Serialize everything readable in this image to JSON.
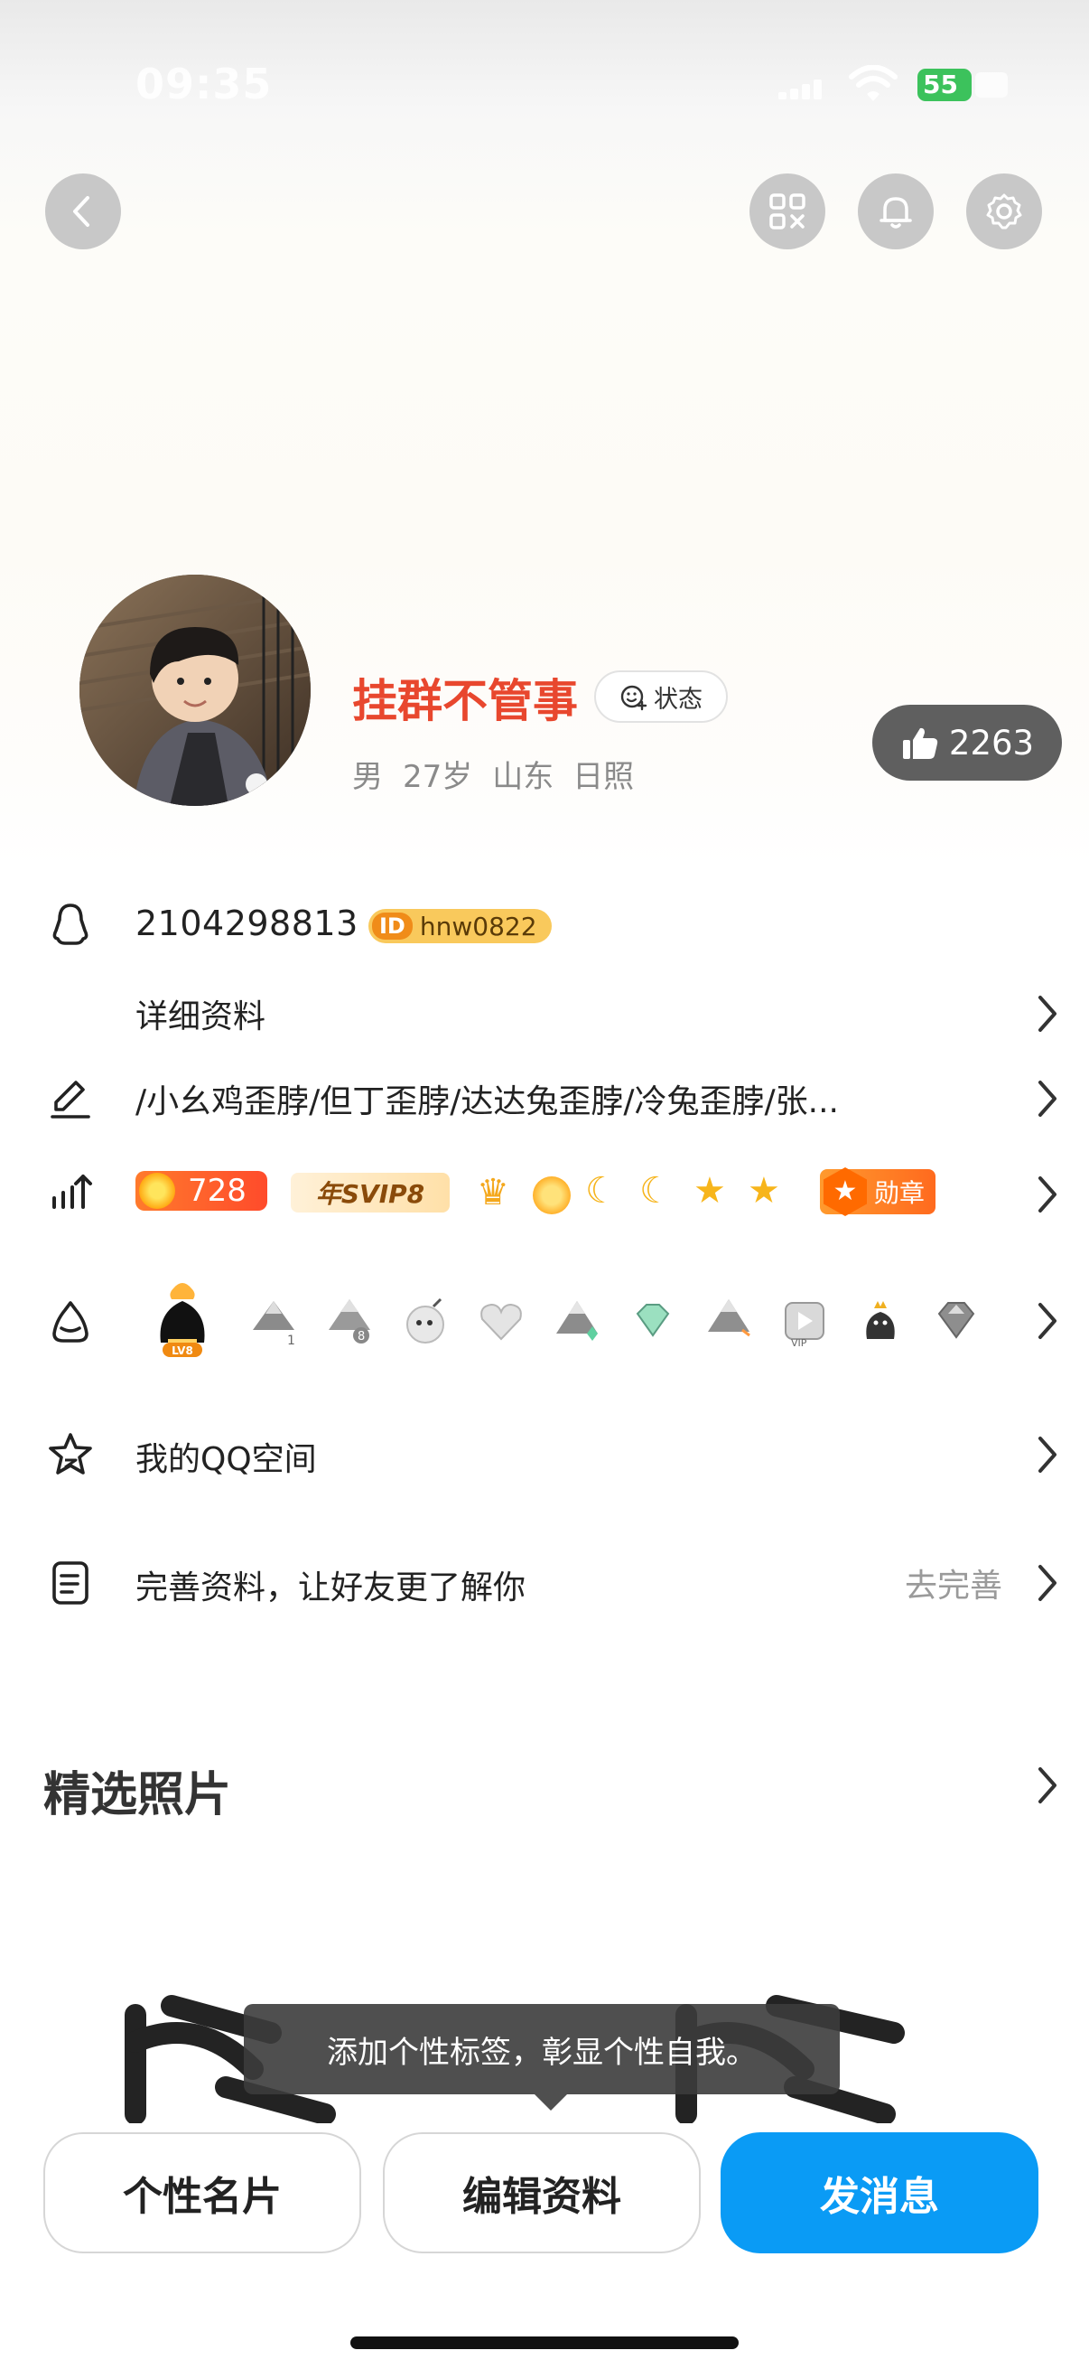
{
  "status_bar": {
    "time": "09:35",
    "battery": "55"
  },
  "nav": {
    "back_icon": "chevron-left-icon",
    "qr_icon": "qr-code-icon",
    "bell_icon": "bell-icon",
    "gear_icon": "gear-icon"
  },
  "profile": {
    "nickname": "挂群不管事",
    "status_label": "状态",
    "gender": "男",
    "age": "27岁",
    "location": "山东 日照",
    "likes": "2263"
  },
  "rows": {
    "qq_number": "2104298813",
    "id_badge_prefix": "ID",
    "id_badge_value": "hnw0822",
    "details_label": "详细资料",
    "signature": "/小幺鸡歪脖/但丁歪脖/达达兔歪脖/冷兔歪脖/张...",
    "level_value": "728",
    "svip_label": "年SVIP8",
    "medal_label": "勋章",
    "badge_lv_label": "LV8",
    "qzone_label": "我的QQ空间",
    "complete_label": "完善资料，让好友更了解你",
    "complete_action": "去完善"
  },
  "photos": {
    "title": "精选照片",
    "tooltip": "添加个性标签，彰显个性自我。"
  },
  "buttons": {
    "card": "个性名片",
    "edit": "编辑资料",
    "message": "发消息"
  },
  "colors": {
    "accent_blue": "#0a9bf5",
    "nickname_red": "#e8472e",
    "like_bg": "#5f5f5f"
  }
}
